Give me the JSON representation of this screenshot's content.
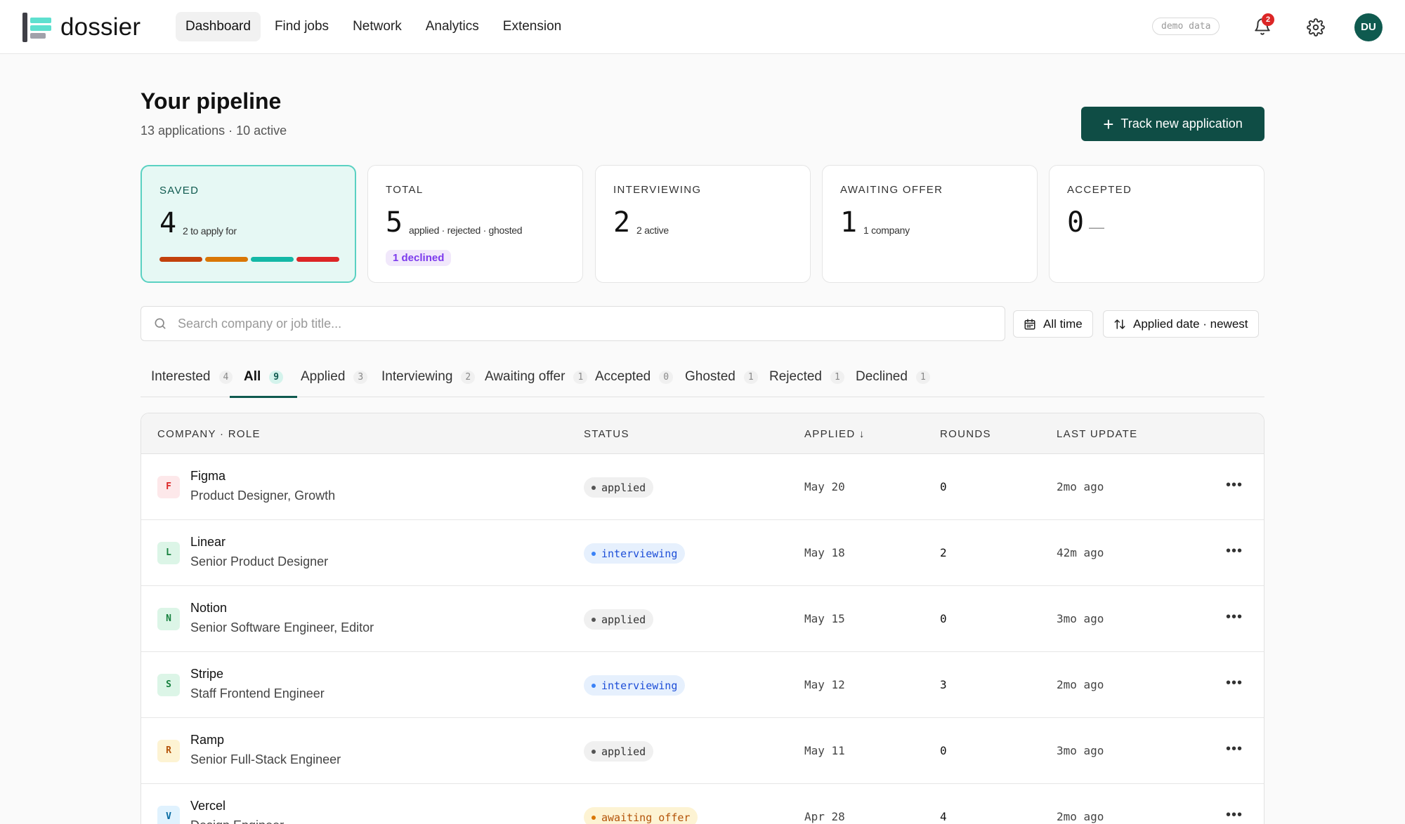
{
  "app": {
    "name": "dossier"
  },
  "nav": {
    "items": [
      {
        "label": "Dashboard",
        "active": true
      },
      {
        "label": "Find jobs"
      },
      {
        "label": "Network"
      },
      {
        "label": "Analytics"
      },
      {
        "label": "Extension"
      }
    ],
    "demo_label": "demo data",
    "notification_count": "2",
    "avatar_initials": "DU"
  },
  "header": {
    "title": "Your pipeline",
    "subtitle": "13 applications · 10 active",
    "track_button": "Track new application"
  },
  "stats": {
    "saved": {
      "label": "SAVED",
      "value": "4",
      "desc": "2 to apply for",
      "progress_colors": [
        "#c2410c",
        "#d97706",
        "#14b8a6",
        "#dc2626"
      ]
    },
    "total": {
      "label": "TOTAL",
      "value": "5",
      "desc": "applied · rejected · ghosted",
      "pill": "1 declined"
    },
    "interviewing": {
      "label": "INTERVIEWING",
      "value": "2",
      "desc": "2 active"
    },
    "awaiting": {
      "label": "AWAITING OFFER",
      "value": "1",
      "desc": "1 company"
    },
    "accepted": {
      "label": "ACCEPTED",
      "value": "0",
      "desc": "—"
    }
  },
  "search": {
    "placeholder": "Search company or job title...",
    "time_filter": "All time",
    "sort": "Applied date · newest"
  },
  "tabs": [
    {
      "label": "Interested",
      "count": "4"
    },
    {
      "label": "All",
      "count": "9",
      "active": true
    },
    {
      "label": "Applied",
      "count": "3"
    },
    {
      "label": "Interviewing",
      "count": "2"
    },
    {
      "label": "Awaiting offer",
      "count": "1"
    },
    {
      "label": "Accepted",
      "count": "0"
    },
    {
      "label": "Ghosted",
      "count": "1"
    },
    {
      "label": "Rejected",
      "count": "1"
    },
    {
      "label": "Declined",
      "count": "1"
    }
  ],
  "table": {
    "columns": {
      "company": "COMPANY · ROLE",
      "status": "STATUS",
      "applied": "APPLIED ↓",
      "rounds": "ROUNDS",
      "updated": "LAST UPDATE"
    },
    "rows": [
      {
        "initial": "F",
        "company": "Figma",
        "role": "Product Designer, Growth",
        "status": "applied",
        "applied": "May 20",
        "rounds": "0",
        "updated": "2mo ago",
        "logo_bg": "#fde8ea",
        "logo_fg": "#dc2626"
      },
      {
        "initial": "L",
        "company": "Linear",
        "role": "Senior Product Designer",
        "status": "interviewing",
        "applied": "May 18",
        "rounds": "2",
        "updated": "42m ago",
        "logo_bg": "#dcf5e7",
        "logo_fg": "#15803d"
      },
      {
        "initial": "N",
        "company": "Notion",
        "role": "Senior Software Engineer, Editor",
        "status": "applied",
        "applied": "May 15",
        "rounds": "0",
        "updated": "3mo ago",
        "logo_bg": "#dcf5e7",
        "logo_fg": "#15803d"
      },
      {
        "initial": "S",
        "company": "Stripe",
        "role": "Staff Frontend Engineer",
        "status": "interviewing",
        "applied": "May 12",
        "rounds": "3",
        "updated": "2mo ago",
        "logo_bg": "#dcf5e7",
        "logo_fg": "#15803d"
      },
      {
        "initial": "R",
        "company": "Ramp",
        "role": "Senior Full-Stack Engineer",
        "status": "applied",
        "applied": "May 11",
        "rounds": "0",
        "updated": "3mo ago",
        "logo_bg": "#fdf3d3",
        "logo_fg": "#b45309"
      },
      {
        "initial": "V",
        "company": "Vercel",
        "role": "Design Engineer",
        "status": "awaiting offer",
        "applied": "Apr 28",
        "rounds": "4",
        "updated": "2mo ago",
        "logo_bg": "#e0f2fe",
        "logo_fg": "#0369a1"
      }
    ]
  },
  "status_styles": {
    "applied": {
      "bg": "#f0f0f0",
      "fg": "#333333",
      "dot": "#555555"
    },
    "interviewing": {
      "bg": "#e6f0fd",
      "fg": "#1d4ed8",
      "dot": "#3b82f6"
    },
    "awaiting offer": {
      "bg": "#fdf3d3",
      "fg": "#b45309",
      "dot": "#d97706"
    }
  },
  "colors": {
    "accent": "#0f4d45",
    "saved_border": "#5ad1c2"
  }
}
